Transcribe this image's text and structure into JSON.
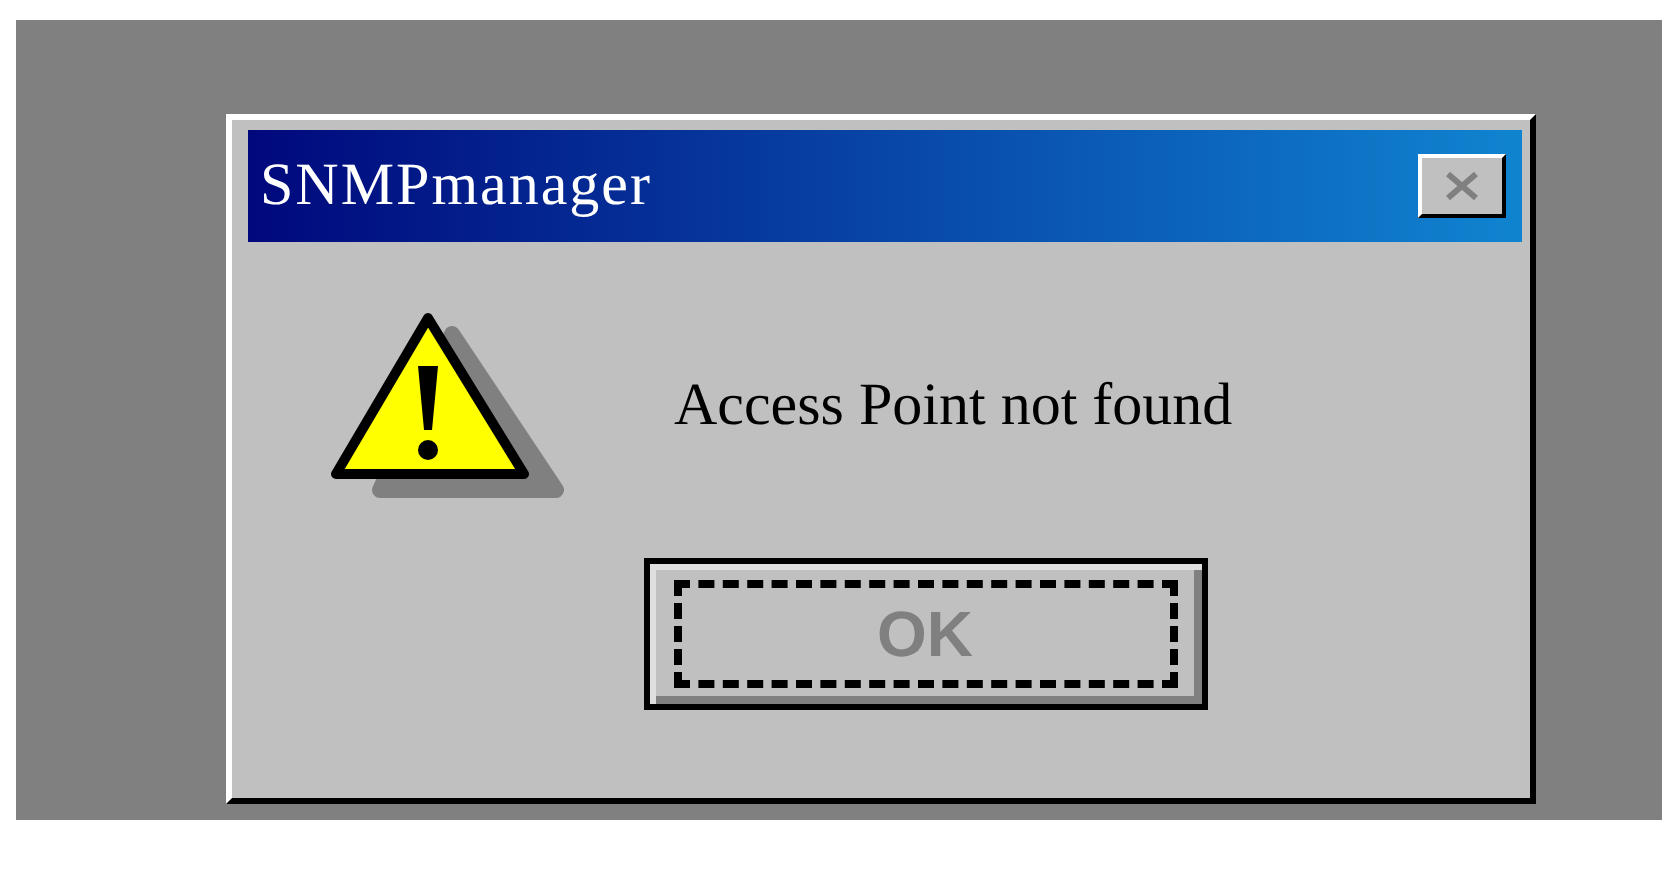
{
  "window": {
    "title": "SNMPmanager",
    "close_button": {
      "disabled": true
    }
  },
  "message": {
    "text": "Access Point not found"
  },
  "buttons": [
    {
      "label": "OK",
      "disabled": true,
      "focused": true
    }
  ]
}
